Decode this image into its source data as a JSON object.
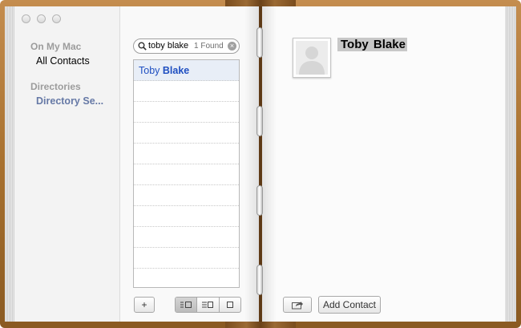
{
  "sidebar": {
    "section1_header": "On My Mac",
    "section1_item": "All Contacts",
    "section2_header": "Directories",
    "section2_item": "Directory Se..."
  },
  "search": {
    "query": "toby blake",
    "result_count": "1 Found"
  },
  "contacts_list": {
    "selected_first": "Toby",
    "selected_last": "Blake"
  },
  "bottom_left": {
    "add_label": "+"
  },
  "detail": {
    "first_name": "Toby",
    "last_name": "Blake",
    "add_contact_label": "Add Contact"
  },
  "icons": [
    "search-icon",
    "clear-icon",
    "view-card-list-icon",
    "view-list-icon",
    "view-card-icon",
    "share-icon",
    "person-placeholder-icon"
  ],
  "colors": {
    "accent_blue": "#1f4fc1",
    "directory_blue": "#6679a6",
    "book_leather": "#a8712f"
  }
}
